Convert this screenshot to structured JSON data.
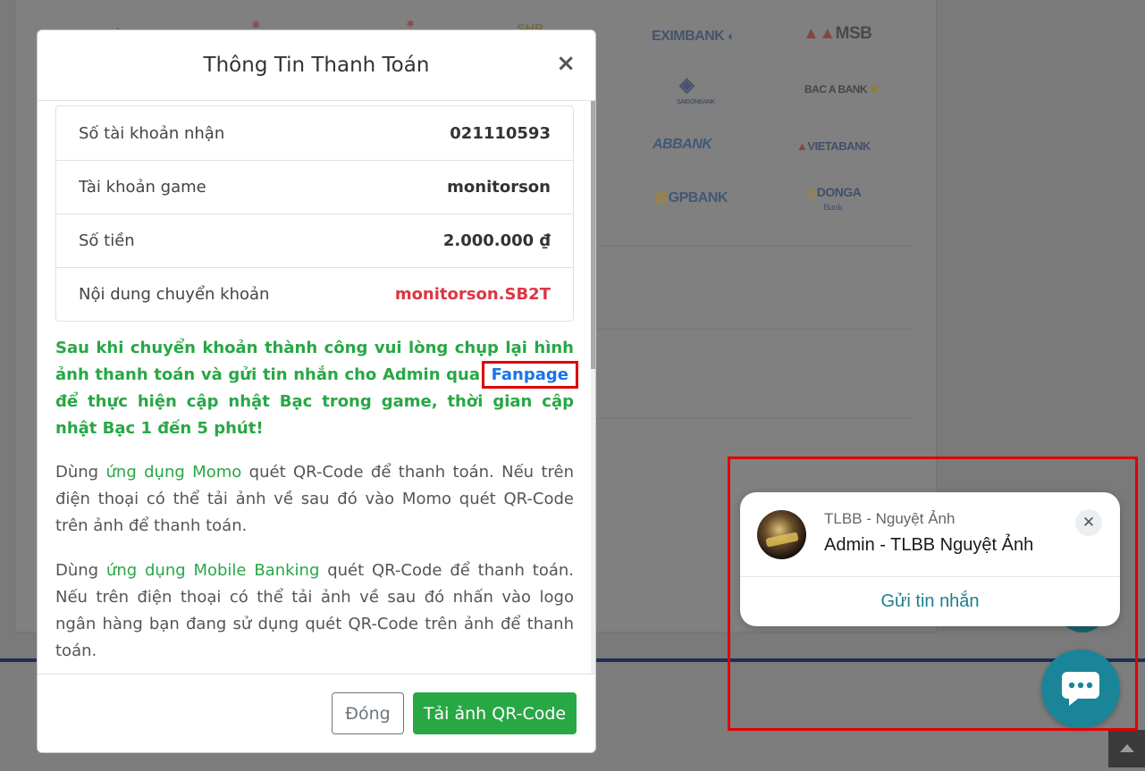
{
  "background": {
    "banks": [
      "EXIMBANK",
      "MSB",
      "BAC A BANK",
      "ABBANK",
      "VIETABANK",
      "GPBANK",
      "DONGA",
      "Bank",
      "SAIGONBANK",
      "SHB"
    ]
  },
  "modal": {
    "title": "Thông Tin Thanh Toán",
    "close_symbol": "×",
    "rows": [
      {
        "label": "Số tài khoản nhận",
        "value": "021110593"
      },
      {
        "label": "Tài khoản game",
        "value": "monitorson"
      },
      {
        "label": "Số tiền",
        "value": "2.000.000 ₫"
      },
      {
        "label": "Nội dung chuyển khoản",
        "value": "monitorson.SB2T"
      }
    ],
    "notice_before": "Sau khi chuyển khoản thành công vui lòng chụp lại hình ảnh thanh toán và gửi tin nhắn cho Admin qua ",
    "notice_link": "Fanpage",
    "notice_after": " để thực hiện cập nhật Bạc trong game, thời gian cập nhật Bạc 1 đến 5 phút!",
    "para1_before": "Dùng ",
    "para1_highlight": "ứng dụng Momo",
    "para1_after": " quét QR-Code để thanh toán. Nếu trên điện thoại có thể tải ảnh về sau đó vào Momo quét QR-Code trên ảnh để thanh toán.",
    "para2_before": "Dùng ",
    "para2_highlight": "ứng dụng Mobile Banking",
    "para2_after": " quét QR-Code để thanh toán. Nếu trên điện thoại có thể tải ảnh về sau đó nhấn vào logo ngân hàng bạn đang sử dụng quét QR-Code trên ảnh để thanh toán.",
    "close_button": "Đóng",
    "qr_button": "Tải ảnh QR-Code"
  },
  "chat": {
    "page_name": "TLBB - Nguyệt Ảnh",
    "admin_name": "Admin - TLBB Nguyệt Ảnh",
    "dismiss_symbol": "✕",
    "send_label": "Gửi tin nhắn",
    "accent_color": "#1a8598",
    "icon": "messenger-chat-icon"
  }
}
